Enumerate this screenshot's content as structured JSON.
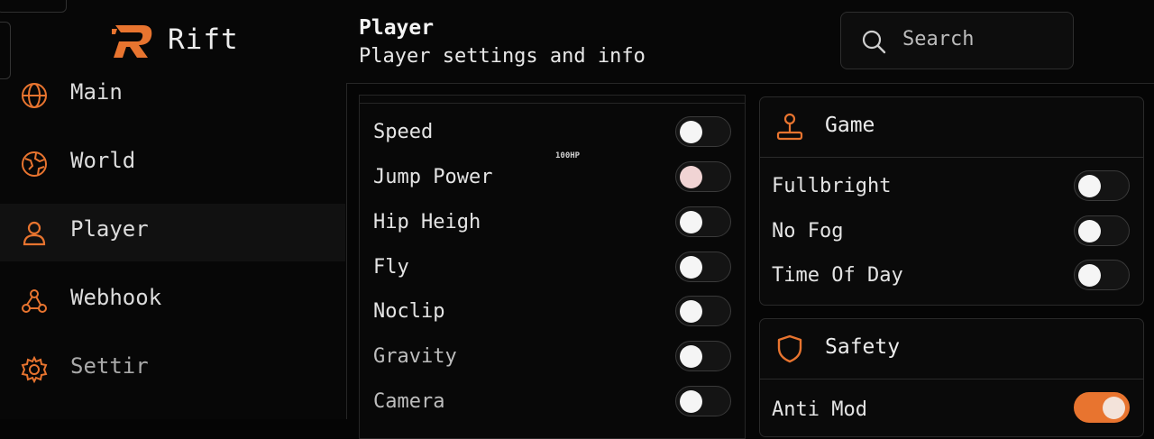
{
  "app": {
    "name": "Rift"
  },
  "colors": {
    "accent": "#e8742f",
    "background": "#050505",
    "panel": "#0a0a0a",
    "border": "#2a2a2a"
  },
  "sidebar": {
    "items": [
      {
        "label": "Main",
        "icon": "globe-icon",
        "active": false
      },
      {
        "label": "World",
        "icon": "earth-icon",
        "active": false
      },
      {
        "label": "Player",
        "icon": "user-icon",
        "active": true
      },
      {
        "label": "Webhook",
        "icon": "webhook-icon",
        "active": false
      },
      {
        "label": "Settir",
        "icon": "gear-icon",
        "active": false
      }
    ]
  },
  "header": {
    "title": "Player",
    "subtitle": "Player settings and info"
  },
  "search": {
    "placeholder": "Search",
    "icon": "search-icon"
  },
  "player_panel": {
    "overlay_tag": "100HP",
    "toggles": [
      {
        "label": "Speed",
        "on": false
      },
      {
        "label": "Jump Power",
        "on": false
      },
      {
        "label": "Hip Heigh",
        "on": false
      },
      {
        "label": "Fly",
        "on": false
      },
      {
        "label": "Noclip",
        "on": false
      },
      {
        "label": "Gravity",
        "on": false
      },
      {
        "label": "Camera",
        "on": false
      }
    ]
  },
  "game_card": {
    "title": "Game",
    "icon": "joystick-icon",
    "toggles": [
      {
        "label": "Fullbright",
        "on": false
      },
      {
        "label": "No Fog",
        "on": false
      },
      {
        "label": "Time Of Day",
        "on": false
      }
    ]
  },
  "safety_card": {
    "title": "Safety",
    "icon": "shield-icon",
    "toggles": [
      {
        "label": "Anti Mod",
        "on": true
      }
    ]
  }
}
